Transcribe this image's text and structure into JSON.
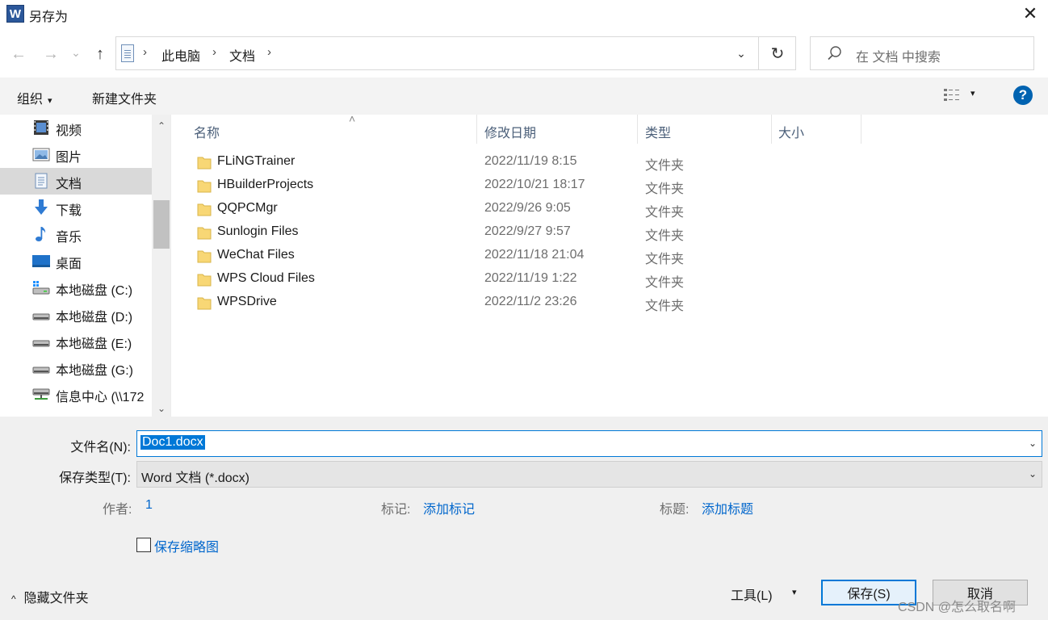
{
  "window": {
    "title": "另存为",
    "app_icon_letter": "W",
    "close_symbol": "✕"
  },
  "navigation": {
    "back_symbol": "←",
    "forward_symbol": "→",
    "recent_symbol": "⌄",
    "up_symbol": "↑",
    "breadcrumb": [
      "此电脑",
      "文档"
    ],
    "separator": "›",
    "dropdown_symbol": "⌄",
    "refresh_symbol": "↻",
    "search_placeholder": "在 文档 中搜索"
  },
  "toolbar": {
    "organize_label": "组织",
    "new_folder_label": "新建文件夹",
    "caret": "▾",
    "help_symbol": "?"
  },
  "sidebar": {
    "items": [
      {
        "label": "视频",
        "icon": "video-icon"
      },
      {
        "label": "图片",
        "icon": "pictures-icon"
      },
      {
        "label": "文档",
        "icon": "documents-icon",
        "selected": true
      },
      {
        "label": "下载",
        "icon": "download-icon"
      },
      {
        "label": "音乐",
        "icon": "music-icon"
      },
      {
        "label": "桌面",
        "icon": "desktop-icon"
      },
      {
        "label": "本地磁盘 (C:)",
        "icon": "system-drive-icon"
      },
      {
        "label": "本地磁盘 (D:)",
        "icon": "drive-icon"
      },
      {
        "label": "本地磁盘 (E:)",
        "icon": "drive-icon"
      },
      {
        "label": "本地磁盘 (G:)",
        "icon": "drive-icon"
      },
      {
        "label": "信息中心 (\\\\172",
        "icon": "network-drive-icon"
      }
    ],
    "scroll_up_symbol": "⌃",
    "scroll_down_symbol": "⌄"
  },
  "file_list": {
    "columns": [
      "名称",
      "修改日期",
      "类型",
      "大小"
    ],
    "sort_symbol": "˄",
    "rows": [
      {
        "name": "FLiNGTrainer",
        "date": "2022/11/19 8:15",
        "type": "文件夹"
      },
      {
        "name": "HBuilderProjects",
        "date": "2022/10/21 18:17",
        "type": "文件夹"
      },
      {
        "name": "QQPCMgr",
        "date": "2022/9/26 9:05",
        "type": "文件夹"
      },
      {
        "name": "Sunlogin Files",
        "date": "2022/9/27 9:57",
        "type": "文件夹"
      },
      {
        "name": "WeChat Files",
        "date": "2022/11/18 21:04",
        "type": "文件夹"
      },
      {
        "name": "WPS Cloud Files",
        "date": "2022/11/19 1:22",
        "type": "文件夹"
      },
      {
        "name": "WPSDrive",
        "date": "2022/11/2 23:26",
        "type": "文件夹"
      }
    ]
  },
  "save_form": {
    "filename_label": "文件名(N):",
    "filename_value": "Doc1.docx",
    "filetype_label": "保存类型(T):",
    "filetype_value": "Word 文档 (*.docx)",
    "combo_caret": "⌄",
    "author_label": "作者:",
    "author_value": "1",
    "tags_label": "标记:",
    "tags_value": "添加标记",
    "title_label": "标题:",
    "title_value": "添加标题",
    "thumbnail_label": "保存缩略图",
    "thumbnail_checked": false
  },
  "footer": {
    "hide_folders_caret": "^",
    "hide_folders_label": "隐藏文件夹",
    "tools_label": "工具(L)",
    "tools_caret": "▾",
    "save_label": "保存(S)",
    "cancel_label": "取消",
    "watermark": "CSDN @怎么取名啊"
  },
  "colors": {
    "accent": "#0078d7",
    "link": "#0066cc",
    "folder": "#f8d775",
    "selected_bg": "#d9d9d9"
  }
}
